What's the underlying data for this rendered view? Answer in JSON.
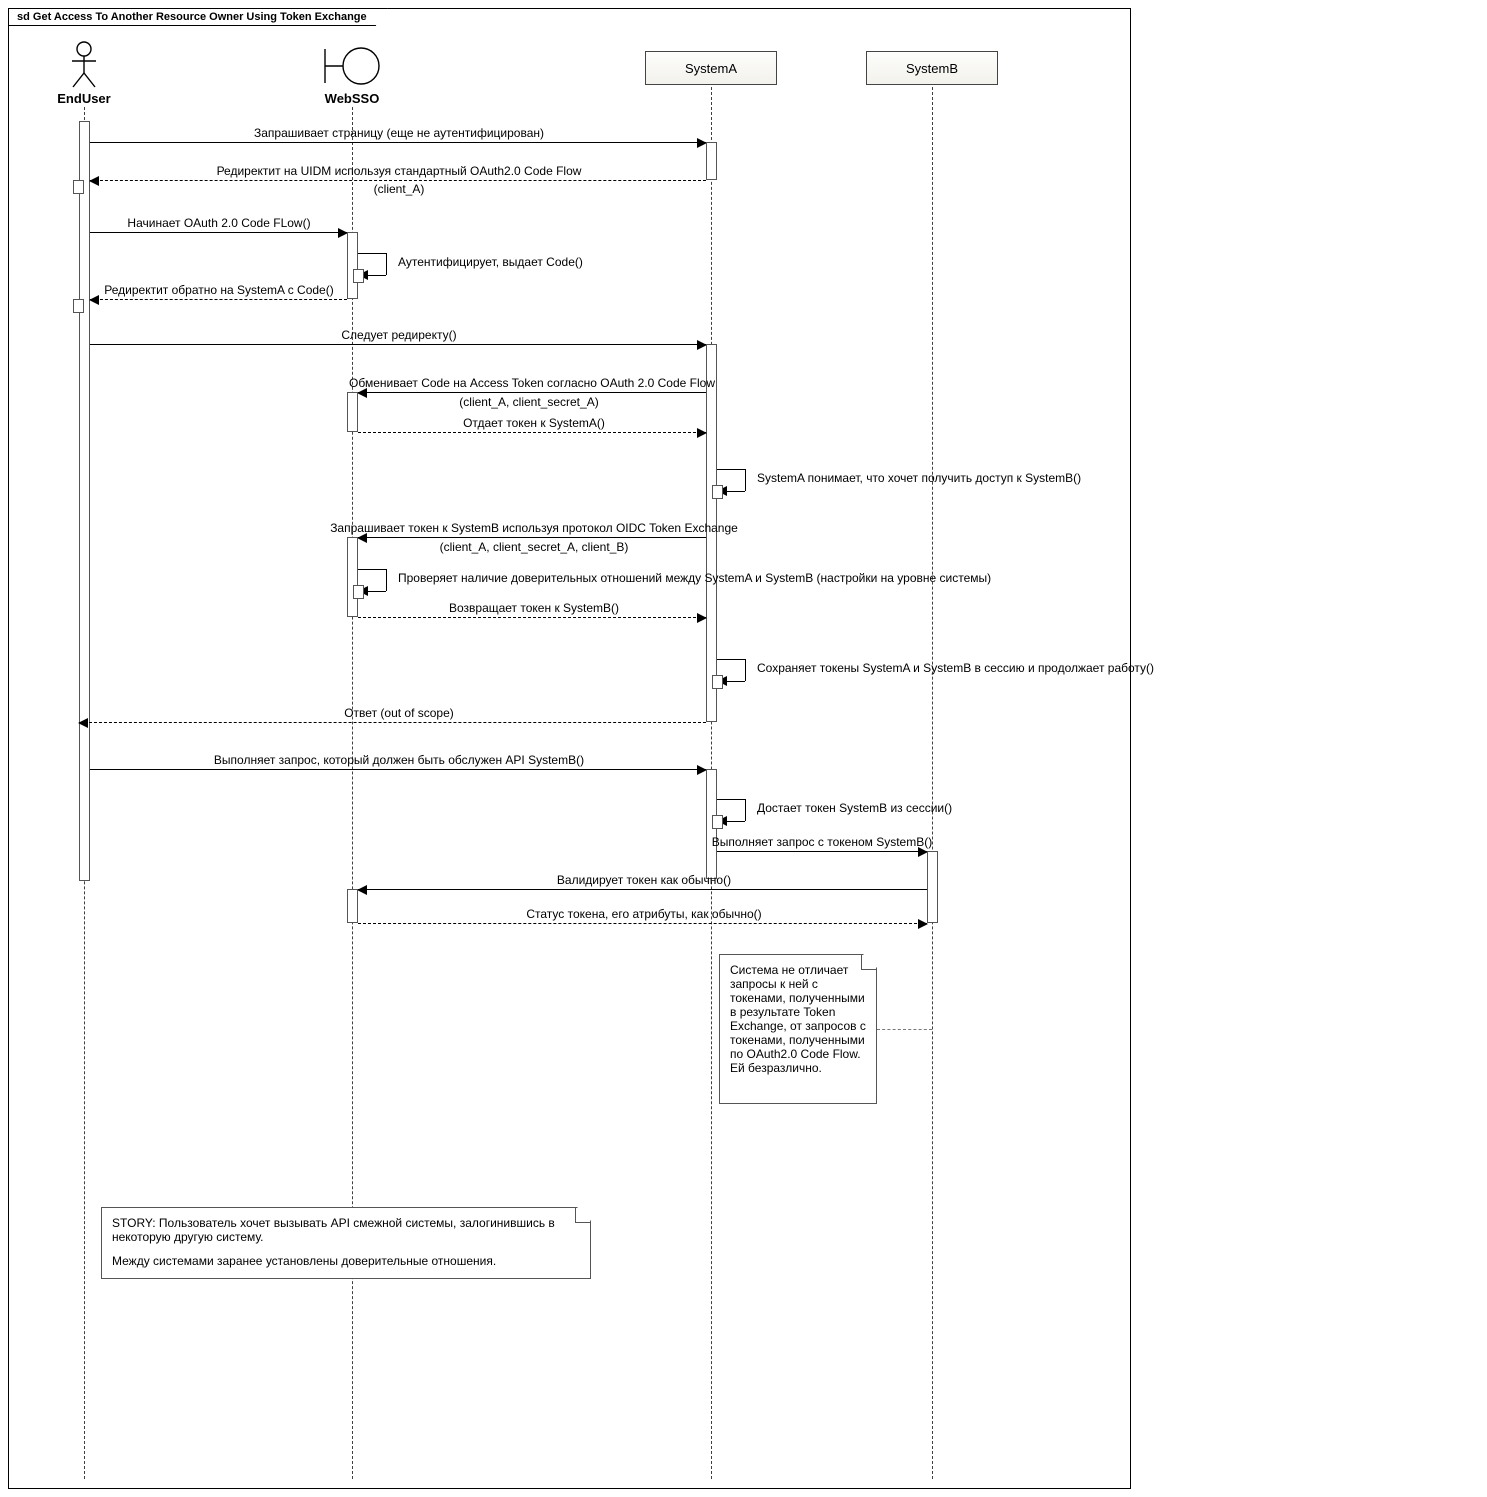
{
  "frame_title": "sd Get Access To Another Resource Owner Using Token Exchange",
  "participants": {
    "enduser": "EndUser",
    "websso": "WebSSO",
    "systemA": "SystemA",
    "systemB": "SystemB"
  },
  "messages": {
    "m1": "Запрашивает страницу (еще не аутентифицирован)",
    "m2a": "Редиректит на UIDM используя стандартный OAuth2.0 Code Flow",
    "m2b": "(client_A)",
    "m3": "Начинает OAuth 2.0 Code FLow()",
    "m4": "Аутентифицирует, выдает Code()",
    "m5": "Редиректит обратно на SystemA с Code()",
    "m6": "Следует редиректу()",
    "m7a": "Обменивает Code на Access Token согласно OAuth 2.0 Code Flow",
    "m7b": "(client_A, client_secret_A)",
    "m8": "Отдает токен к SystemA()",
    "m9": "SystemA понимает, что хочет получить доступ к SystemB()",
    "m10a": "Запрашивает токен к SystemB используя протокол OIDC Token Exchange",
    "m10b": "(client_A, client_secret_A, client_B)",
    "m11": "Проверяет наличие доверительных отношений между SystemA и SystemB (настройки на уровне системы)",
    "m12": "Возвращает токен к SystemB()",
    "m13": "Сохраняет токены SystemA и SystemB в сессию и продолжает работу()",
    "m14": "Ответ (out of scope)",
    "m15": "Выполняет запрос, который должен быть обслужен API SystemB()",
    "m16": "Достает токен SystemB из сессии()",
    "m17": "Выполняет запрос с токеном SystemB()",
    "m18": "Валидирует токен как обычно()",
    "m19": "Статус токена, его атрибуты, как обычно()"
  },
  "note_systemB": "Система не отличает запросы к ней с токенами, полученными в результате Token Exchange, от запросов с токенами, полученными по OAuth2.0 Code Flow. Ей безразлично.",
  "note_story_line1": "STORY: Пользователь хочет вызывать API смежной системы, залогинившись в некоторую другую систему.",
  "note_story_line2": "Между системами заранее установлены доверительные отношения."
}
